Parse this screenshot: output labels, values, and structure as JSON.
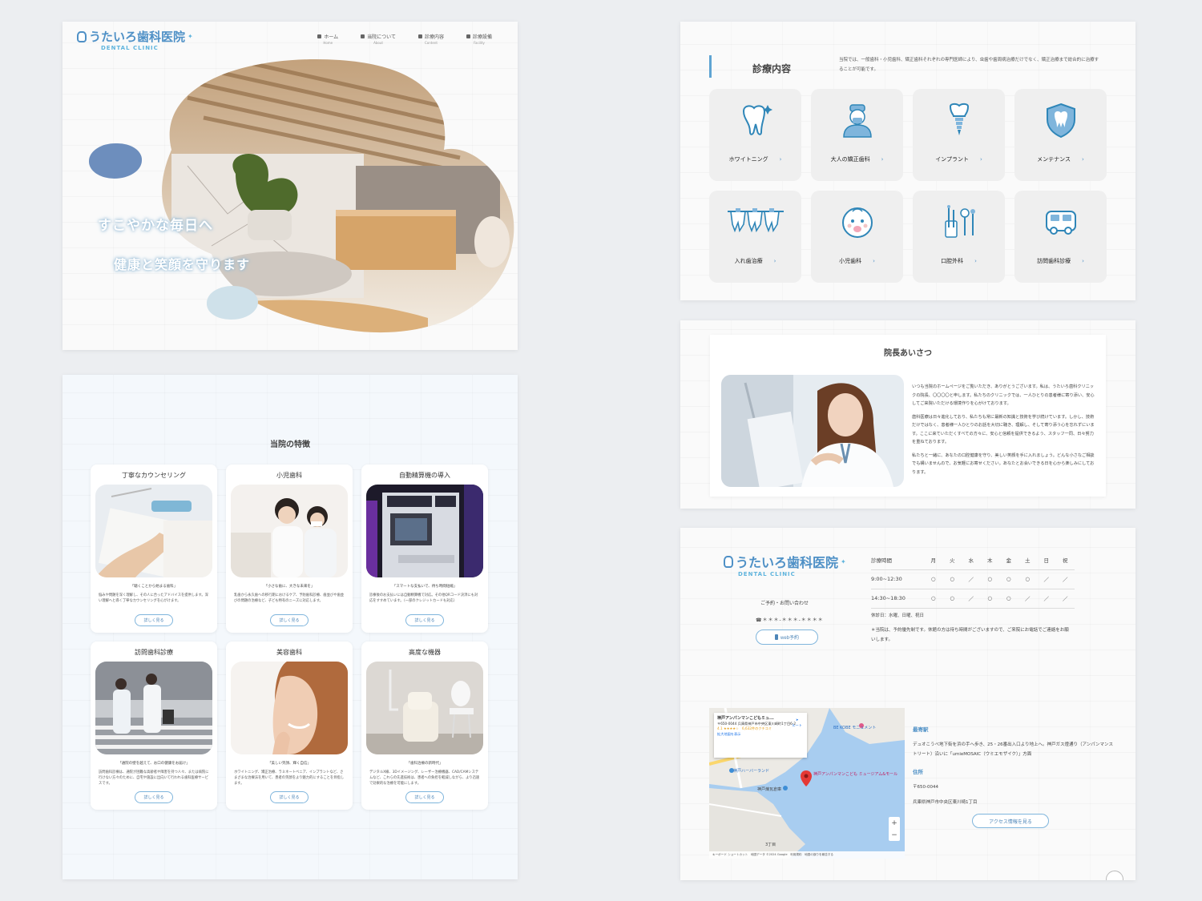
{
  "brand": {
    "name_jp": "うたいろ歯科医院",
    "name_en": "DENTAL CLINIC"
  },
  "nav": [
    {
      "jp": "ホーム",
      "en": "Home"
    },
    {
      "jp": "当院について",
      "en": "About"
    },
    {
      "jp": "診療内容",
      "en": "Content"
    },
    {
      "jp": "診療設備",
      "en": "Facility"
    }
  ],
  "hero": {
    "copy1": "すこやかな毎日へ",
    "copy2": "健康と笑顔を守ります"
  },
  "features": {
    "title": "当院の特徴",
    "more_label": "詳しく見る",
    "items": [
      {
        "title": "丁寧なカウンセリング",
        "quote": "「聴くことから始まる歯科」",
        "desc": "悩みや問題を深く理解し、その人に合ったアドバイスを提供します。深い理解へと導く丁寧なカウンセリングを心がけます。"
      },
      {
        "title": "小児歯科",
        "quote": "「小さな歯に、大きな未来を」",
        "desc": "乳歯から永久歯への移行期におけるケア、予防歯科診療、歯並びや歯並びの問題の治療など、子ども特有のニーズに対応します。"
      },
      {
        "title": "自動精算機の導入",
        "quote": "「スマートな支払いで、待ち時間短縮」",
        "desc": "診療後のお支払いには自動精算機で対応。その他QRコード決済にも対応をすすめています。（一部のクレジットカードも対応）"
      },
      {
        "title": "訪問歯科診療",
        "quote": "「通院の壁を越えて、お口の健康をお届け」",
        "desc": "訪問歯科診療は、通院が困難な高齢者や障害を持つ人々、または病院に行けない方々のために、自宅や施設に出向いて行われる歯科医療サービスです。"
      },
      {
        "title": "美容歯科",
        "quote": "「美しい笑顔、輝く自信」",
        "desc": "ホワイトニング、矯正治療、ラミネートベニア、インプラントなど、さまざまな治療法を用いて、患者の笑顔をより魅力的にすることを目指します。"
      },
      {
        "title": "高度な機器",
        "quote": "「歯科治療の新時代」",
        "desc": "デジタルX線、3Dイメージング、レーザー治療機器、CAD/CAMシステムなど、これらの先進技術は、患者への負担を軽減しながら、より迅速で効果的な治療を可能にします。"
      }
    ]
  },
  "services": {
    "title": "診療内容",
    "desc": "当院では、一般歯科・小児歯科、矯正歯科それぞれの専門医師により、虫歯や歯周病治療だけでなく、矯正治療まで総合的に治療することが可能です。",
    "items": [
      {
        "label": "ホワイトニング",
        "icon": "sparkle-tooth-icon"
      },
      {
        "label": "大人の矯正歯科",
        "icon": "dentist-icon"
      },
      {
        "label": "インプラント",
        "icon": "implant-icon"
      },
      {
        "label": "メンテナンス",
        "icon": "shield-tooth-icon"
      },
      {
        "label": "入れ歯治療",
        "icon": "denture-icon"
      },
      {
        "label": "小児歯科",
        "icon": "baby-icon"
      },
      {
        "label": "口腔外科",
        "icon": "dental-tools-icon"
      },
      {
        "label": "訪問歯科診療",
        "icon": "bus-icon"
      }
    ]
  },
  "greeting": {
    "title": "院長あいさつ",
    "paragraphs": [
      "いつも当院のホームページをご覧いただき、ありがとうございます。私は、うたいろ歯科クリニックの院長、〇〇〇〇と申します。私たちのクリニックでは、一人ひとりの患者様に寄り添い、安心してご来院いただける環境作りを心がけております。",
      "歯科医療は日々進化しており、私たちも常に最新の知識と技術を学び続けています。しかし、技術だけではなく、患者様一人ひとりのお話を大切に聴き、理解し、そして寄り添う心を忘れずにいます。ここに来ていただくすべての方々に、安心と信頼を提供できるよう、スタッフ一同、日々努力を重ねております。",
      "私たちと一緒に、あなたの口腔健康を守り、美しい笑顔を手に入れましょう。どんな小さなご相談でも構いませんので、お気軽にお寄せください。あなたとお会いできる日を心から楽しみにしております。"
    ]
  },
  "access": {
    "reserve_label": "ご予約・お問い合わせ",
    "tel": "☎＊＊＊-＊＊＊-＊＊＊＊",
    "web_button": "web予約",
    "hours": {
      "header": [
        "診療時間",
        "月",
        "火",
        "水",
        "木",
        "金",
        "土",
        "日",
        "祝"
      ],
      "rows": [
        {
          "time": "9:00~12:30",
          "marks": [
            "○",
            "○",
            "／",
            "○",
            "○",
            "○",
            "／",
            "／"
          ]
        },
        {
          "time": "14:30~18:30",
          "marks": [
            "○",
            "○",
            "／",
            "○",
            "○",
            "／",
            "／",
            "／"
          ]
        }
      ]
    },
    "closed": "休診日：水曜、日曜、祝日",
    "note": "＊当院は、予約優先制です。休館の方は待ち時間がございますので、ご来院にお電話でご連絡をお願いします。",
    "map": {
      "place": "神戸アンパンマンこどもミュ...",
      "address": "〒650-0044 兵庫県神戸市中央区東川崎町1丁目6-2",
      "rating": "4.1 ★★★★☆　6,632件のクチコミ",
      "link": "拡大地図を表示",
      "route": "ルート",
      "footer": "キーボード ショートカット　地図データ ©2024 Google　利用規約　地図の誤りを報告する",
      "labels": [
        "神戸ハーバーランド",
        "神戸アンパンマンこども ミュージアム&モール",
        "BE KOBE モニュメント",
        "神戸煉瓦倉庫",
        "3丁目"
      ]
    },
    "station_h": "最寄駅",
    "station_t": "デュオこうべ地下街を浜の手へ歩き、25・26番出入口より地上へ。神戸ガス燈通り（アンパンマンストリート）沿いに「umieMOSAIC（ウミエモザイク）」方面",
    "address_h": "住所",
    "zip": "〒650-0044",
    "address": "兵庫県神戸市中央区東川崎1丁目",
    "access_button": "アクセス情報を見る"
  }
}
